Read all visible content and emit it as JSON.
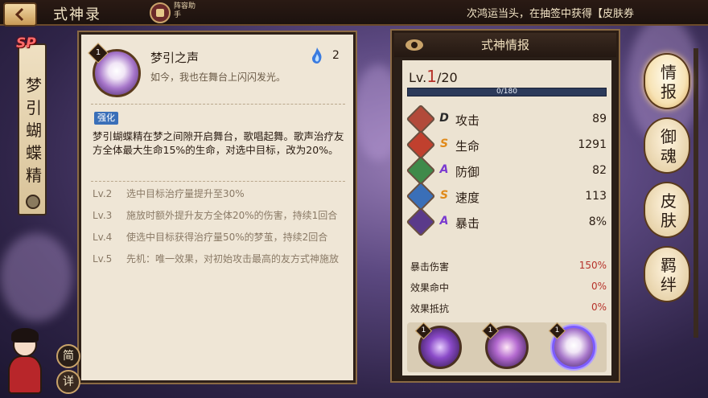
{
  "topbar": {
    "title": "式神录",
    "assistant_label": "阵容助手",
    "marquee": "次鸿运当头，在抽签中获得【皮肤券"
  },
  "shikigami": {
    "rarity": "SP",
    "name": "梦引蝴蝶精"
  },
  "skill": {
    "level": "1",
    "name": "梦引之声",
    "quote": "如今，我也在舞台上闪闪发光。",
    "cost": "2",
    "enhance_tag": "强化",
    "description": "梦引蝴蝶精在梦之间隙开启舞台，歌唱起舞。歌声治疗友方全体最大生命15%的生命，对选中目标，改为20%。",
    "upgrades": [
      {
        "lv": "Lv.2",
        "text": "选中目标治疗量提升至30%"
      },
      {
        "lv": "Lv.3",
        "text": "施放时额外提升友方全体20%的伤害，持续1回合"
      },
      {
        "lv": "Lv.4",
        "text": "使选中目标获得治疗量50%的梦茧，持续2回合"
      },
      {
        "lv": "Lv.5",
        "text": "先机：唯一效果，对初始攻击最高的友方式神施放"
      }
    ]
  },
  "info": {
    "title": "式神情报",
    "lv_prefix": "Lv.",
    "lv_current": "1",
    "lv_max": "/20",
    "exp_text": "0/180",
    "exp_fraction": 0.0,
    "stats": [
      {
        "label": "攻击",
        "grade": "D",
        "value": "89",
        "icon": "attack-icon",
        "color": "#b24a3a"
      },
      {
        "label": "生命",
        "grade": "S",
        "value": "1291",
        "icon": "health-icon",
        "color": "#c0402e"
      },
      {
        "label": "防御",
        "grade": "A",
        "value": "82",
        "icon": "defense-icon",
        "color": "#3f8a4a"
      },
      {
        "label": "速度",
        "grade": "S",
        "value": "113",
        "icon": "speed-icon",
        "color": "#3a6fb8"
      },
      {
        "label": "暴击",
        "grade": "A",
        "value": "8%",
        "icon": "crit-icon",
        "color": "#5a3a8a"
      }
    ],
    "sub_stats": [
      {
        "label": "暴击伤害",
        "value": "150%"
      },
      {
        "label": "效果命中",
        "value": "0%"
      },
      {
        "label": "效果抵抗",
        "value": "0%"
      }
    ],
    "skill_levels": [
      "1",
      "1",
      "1"
    ]
  },
  "side_tabs": [
    "情报",
    "御魂",
    "皮肤",
    "羁绊"
  ],
  "bottom": {
    "simple_label": "简",
    "detail_label": "详"
  },
  "colors": {
    "accent_red": "#b6322a",
    "grade_S": "#e08a1a",
    "grade_A": "#7a3ad0",
    "grade_D": "#2a2a2a",
    "exp_bar": "#2c3a5a"
  }
}
